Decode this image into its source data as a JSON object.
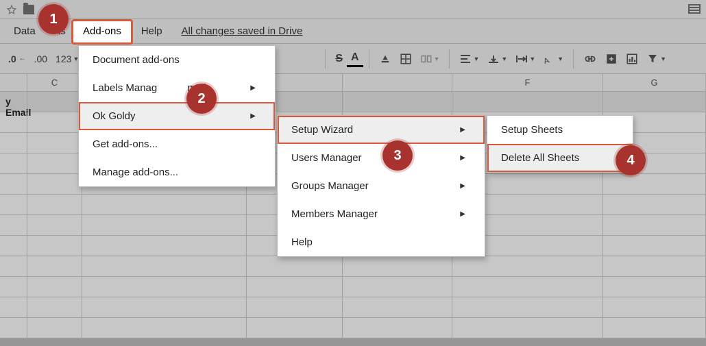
{
  "topbar": {},
  "menubar": {
    "data": "Data",
    "partial": "ls",
    "addons": "Add-ons",
    "help": "Help",
    "drive_status": "All changes saved in Drive"
  },
  "toolbar": {
    "decimal_inc": ".00",
    "format_more": "123"
  },
  "columns": {
    "c": "C",
    "f": "F",
    "g": "G"
  },
  "header_cell": "y Email",
  "menu1": {
    "doc_addons": "Document add-ons",
    "labels_mgr": "Labels Manag",
    "labels_mgr_suffix": "mail",
    "ok_goldy": "Ok Goldy",
    "get_addons": "Get add-ons...",
    "manage_addons": "Manage add-ons..."
  },
  "menu2": {
    "setup_wizard": "Setup Wizard",
    "users_mgr": "Users Manager",
    "groups_mgr": "Groups Manager",
    "members_mgr": "Members Manager",
    "help": "Help"
  },
  "menu3": {
    "setup_sheets": "Setup Sheets",
    "delete_all": "Delete All Sheets"
  },
  "badges": {
    "b1": "1",
    "b2": "2",
    "b3": "3",
    "b4": "4"
  }
}
